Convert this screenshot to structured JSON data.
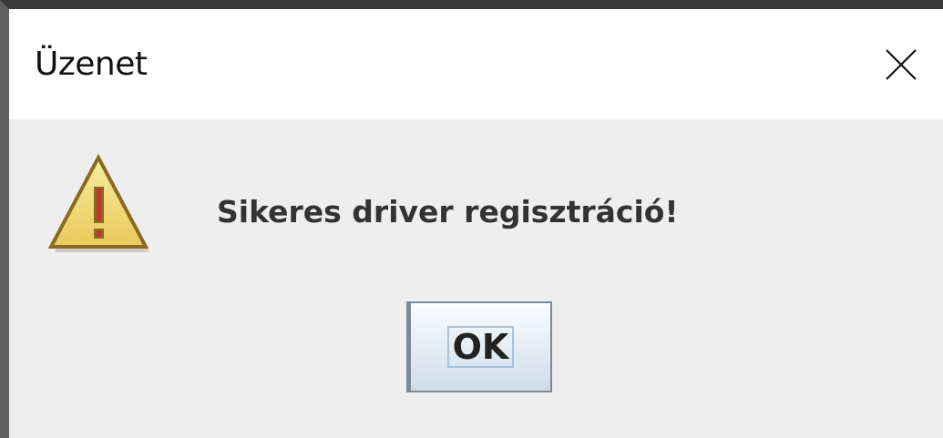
{
  "window": {
    "title": "Üzenet"
  },
  "dialog": {
    "icon": "warning-icon",
    "message": "Sikeres driver regisztráció!",
    "ok_label": "OK"
  },
  "colors": {
    "titlebar": "#ffffff",
    "body": "#eeeeee",
    "warning_fill": "#f2dd7c",
    "warning_outline": "#8a6a22",
    "text": "#333333"
  }
}
